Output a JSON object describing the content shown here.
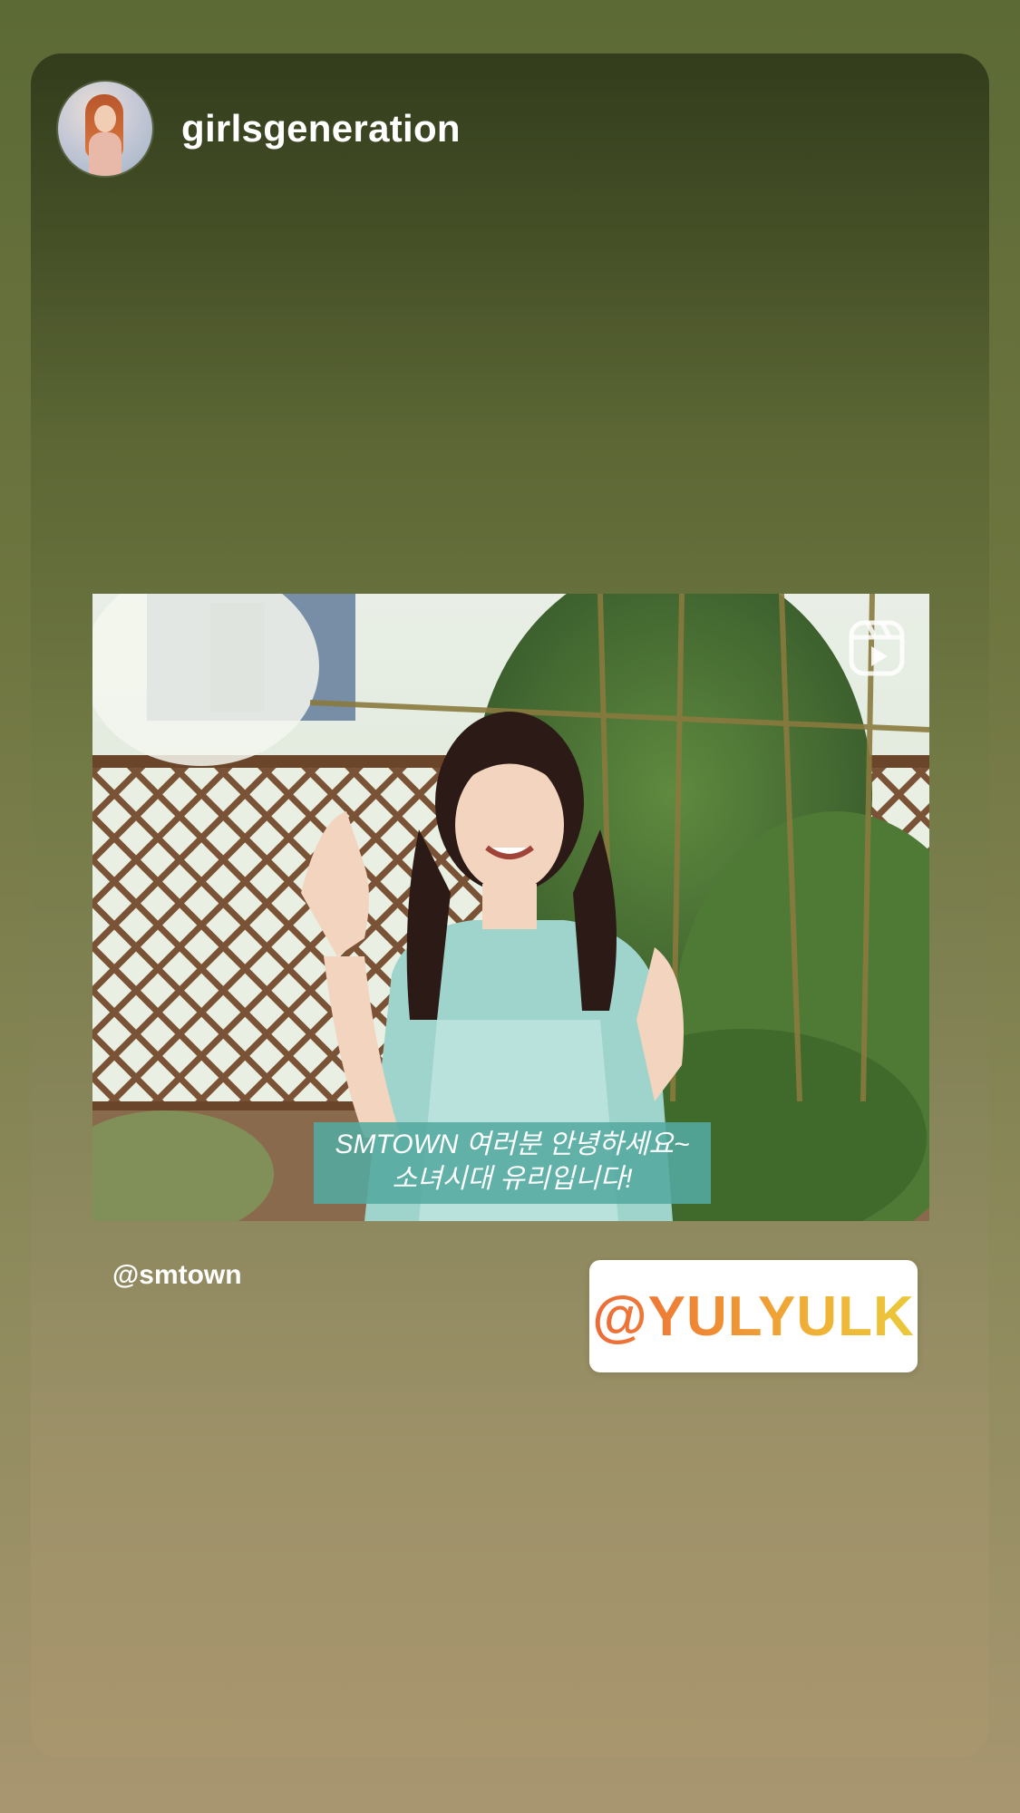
{
  "story": {
    "username": "girlsgeneration",
    "avatar_icon": "profile-avatar",
    "video": {
      "caption_line1": "SMTOWN 여러분 안녕하세요~",
      "caption_line2": "소녀시대 유리입니다!",
      "reel_icon": "reels-play-icon"
    },
    "mention_text": "@smtown",
    "sticker_text": "@YULYULK"
  },
  "colors": {
    "caption_bg": "#54aaa0",
    "sticker_gradient_start": "#ec6a38",
    "sticker_gradient_end": "#ecc93a"
  }
}
